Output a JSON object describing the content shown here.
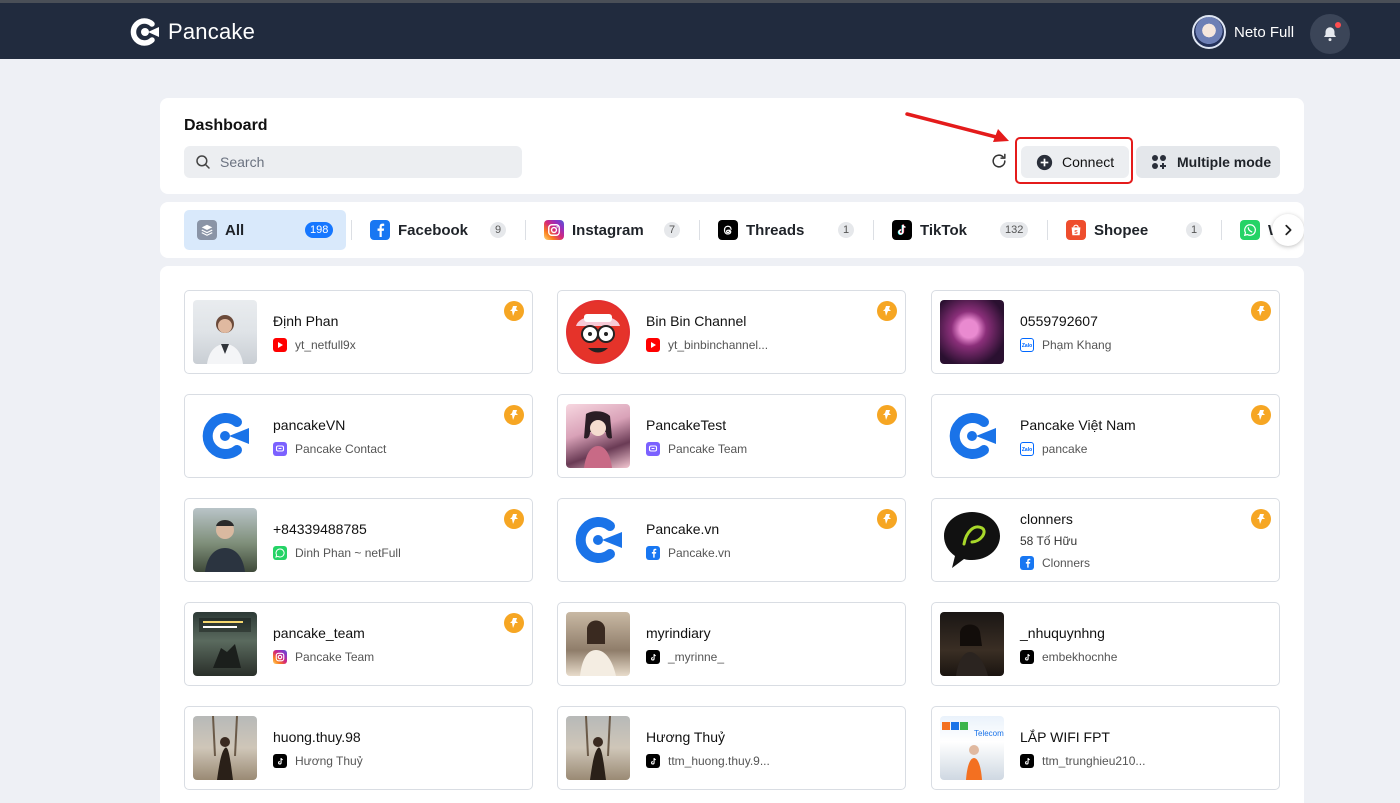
{
  "app": {
    "brand": "Pancake",
    "user_name": "Neto Full"
  },
  "dashboard": {
    "title": "Dashboard",
    "search_placeholder": "Search",
    "connect_label": "Connect",
    "multiple_mode_label": "Multiple mode"
  },
  "tabs": [
    {
      "label": "All",
      "count": "198",
      "icon": "layers-icon",
      "color": "#8a94a6"
    },
    {
      "label": "Facebook",
      "count": "9",
      "icon": "facebook-icon",
      "color": "#1877f2"
    },
    {
      "label": "Instagram",
      "count": "7",
      "icon": "instagram-icon",
      "color": "#e1306c"
    },
    {
      "label": "Threads",
      "count": "1",
      "icon": "threads-icon",
      "color": "#000000"
    },
    {
      "label": "TikTok",
      "count": "132",
      "icon": "tiktok-icon",
      "color": "#000000"
    },
    {
      "label": "Shopee",
      "count": "1",
      "icon": "shopee-icon",
      "color": "#ee4d2d"
    },
    {
      "label": "W",
      "icon": "whatsapp-icon",
      "color": "#25d366"
    }
  ],
  "pages": [
    {
      "name": "Định Phan",
      "sub": "yt_netfull9x",
      "platform": "youtube"
    },
    {
      "name": "Bin Bin Channel",
      "sub": "yt_binbinchannel...",
      "platform": "youtube"
    },
    {
      "name": "0559792607",
      "sub": "Phạm Khang",
      "platform": "zalo"
    },
    {
      "name": "pancakeVN",
      "sub": "Pancake Contact",
      "platform": "messenger-bot"
    },
    {
      "name": "PancakeTest",
      "sub": "Pancake Team",
      "platform": "messenger-bot"
    },
    {
      "name": "Pancake Việt Nam",
      "sub": "pancake",
      "platform": "zalo"
    },
    {
      "name": "+84339488785",
      "sub": "Dinh Phan ~ netFull",
      "platform": "whatsapp"
    },
    {
      "name": "Pancake.vn",
      "sub": "Pancake.vn",
      "platform": "facebook"
    },
    {
      "name": "clonners",
      "address": "58 Tố Hữu",
      "sub": "Clonners",
      "platform": "facebook"
    },
    {
      "name": "pancake_team",
      "sub": "Pancake Team",
      "platform": "instagram"
    },
    {
      "name": "myrindiary",
      "sub": "_myrinne_",
      "platform": "tiktok"
    },
    {
      "name": "_nhuquynhng",
      "sub": "embekhocnhe",
      "platform": "tiktok"
    },
    {
      "name": "huong.thuy.98",
      "sub": "Hương Thuỷ",
      "platform": "tiktok"
    },
    {
      "name": "Hương Thuỷ",
      "sub": "ttm_huong.thuy.9...",
      "platform": "tiktok"
    },
    {
      "name": "LẮP WIFI FPT",
      "sub": "ttm_trunghieu210...",
      "platform": "tiktok"
    }
  ]
}
